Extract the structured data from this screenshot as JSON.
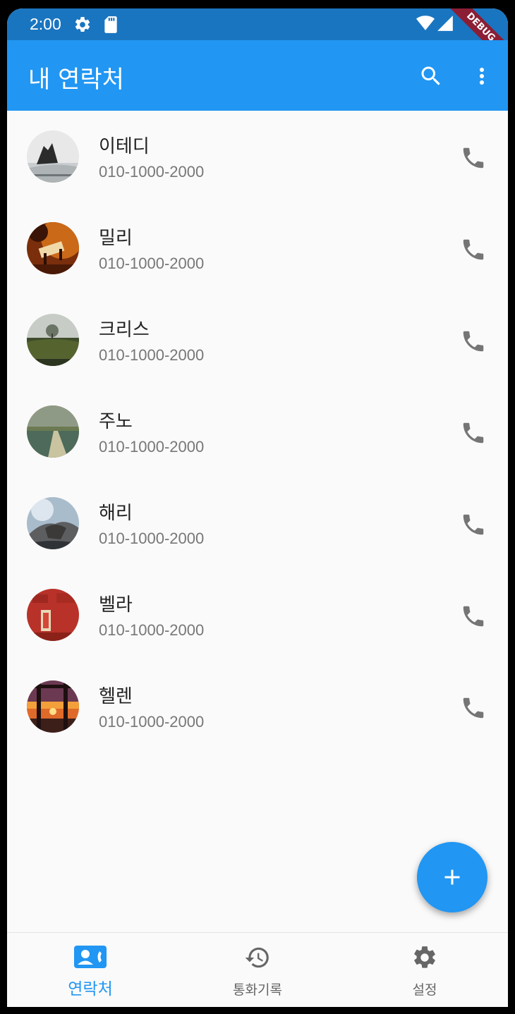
{
  "status_bar": {
    "time": "2:00",
    "debug_label": "DEBUG"
  },
  "app_bar": {
    "title": "내 연락처"
  },
  "contacts": [
    {
      "name": "이테디",
      "phone": "010-1000-2000"
    },
    {
      "name": "밀리",
      "phone": "010-1000-2000"
    },
    {
      "name": "크리스",
      "phone": "010-1000-2000"
    },
    {
      "name": "주노",
      "phone": "010-1000-2000"
    },
    {
      "name": "해리",
      "phone": "010-1000-2000"
    },
    {
      "name": "벨라",
      "phone": "010-1000-2000"
    },
    {
      "name": "헬렌",
      "phone": "010-1000-2000"
    }
  ],
  "bottom_nav": {
    "items": [
      {
        "label": "연락처",
        "icon": "contacts-icon",
        "active": true
      },
      {
        "label": "통화기록",
        "icon": "history-icon",
        "active": false
      },
      {
        "label": "설정",
        "icon": "settings-icon",
        "active": false
      }
    ]
  },
  "colors": {
    "primary": "#2196f3",
    "status_bar": "#1a75c0",
    "background": "#fafafa",
    "icon_gray": "#757575"
  }
}
